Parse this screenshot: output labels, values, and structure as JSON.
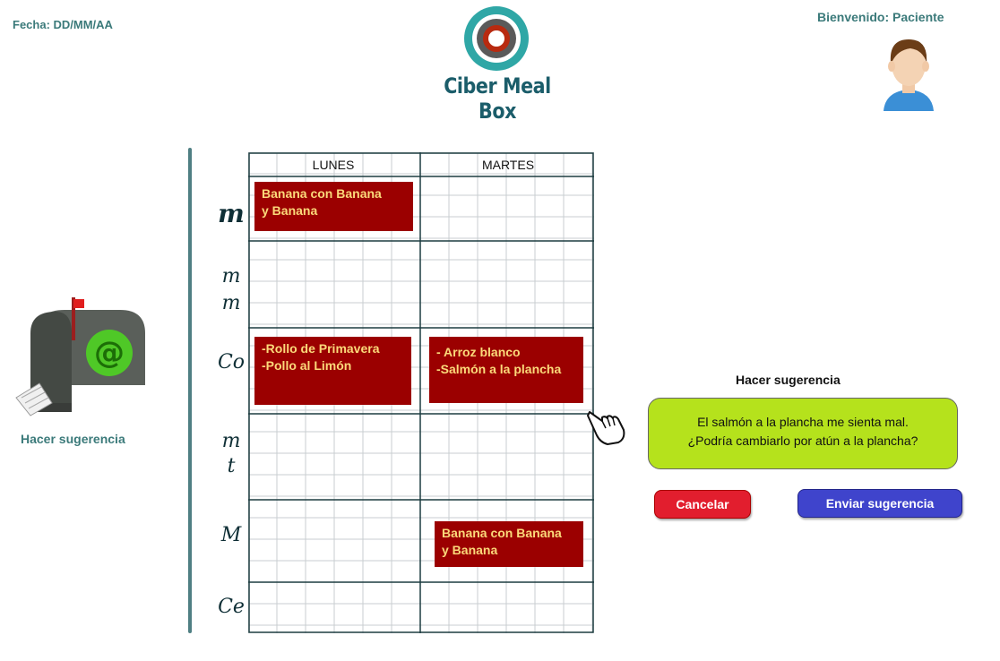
{
  "header": {
    "date_label": "Fecha: DD/MM/AA",
    "welcome_label": "Bienvenido: Paciente",
    "app_title": "Ciber Meal Box",
    "logo_icon": "ring-logo-icon",
    "avatar_icon": "user-avatar-icon"
  },
  "left": {
    "mailbox_icon": "mailbox-icon",
    "suggest_label": "Hacer sugerencia"
  },
  "calendar": {
    "days": [
      "LUNES",
      "MARTES"
    ],
    "rows": [
      "M",
      "mm",
      "Co",
      "mt",
      "M",
      "Ce"
    ],
    "rows_display": {
      "r0": "m",
      "r1a": "m",
      "r1b": "m",
      "r2": "Co",
      "r3a": "m",
      "r3b": "t",
      "r4": "M",
      "r5": "Ce"
    },
    "meals": [
      {
        "day": "LUNES",
        "row": "M",
        "text": "Banana con Banana\ny Banana"
      },
      {
        "day": "LUNES",
        "row": "Co",
        "text": "-Rollo de Primavera\n-Pollo al Limón"
      },
      {
        "day": "MARTES",
        "row": "Co",
        "text": "- Arroz blanco\n-Salmón a la plancha"
      },
      {
        "day": "MARTES",
        "row": "M",
        "text": "Banana con Banana\ny Banana"
      }
    ]
  },
  "suggestion": {
    "title": "Hacer sugerencia",
    "text": "El salmón a la plancha me sienta mal.\n¿Podría cambiarlo por atún a la plancha?",
    "cancel_label": "Cancelar",
    "send_label": "Enviar sugerencia"
  },
  "colors": {
    "accent_teal": "#3b7a7a",
    "meal_block": "#9b0000",
    "meal_text": "#fbd97a",
    "suggest_box": "#b5e21c",
    "cancel": "#e21e2e",
    "send": "#3f44cc"
  }
}
